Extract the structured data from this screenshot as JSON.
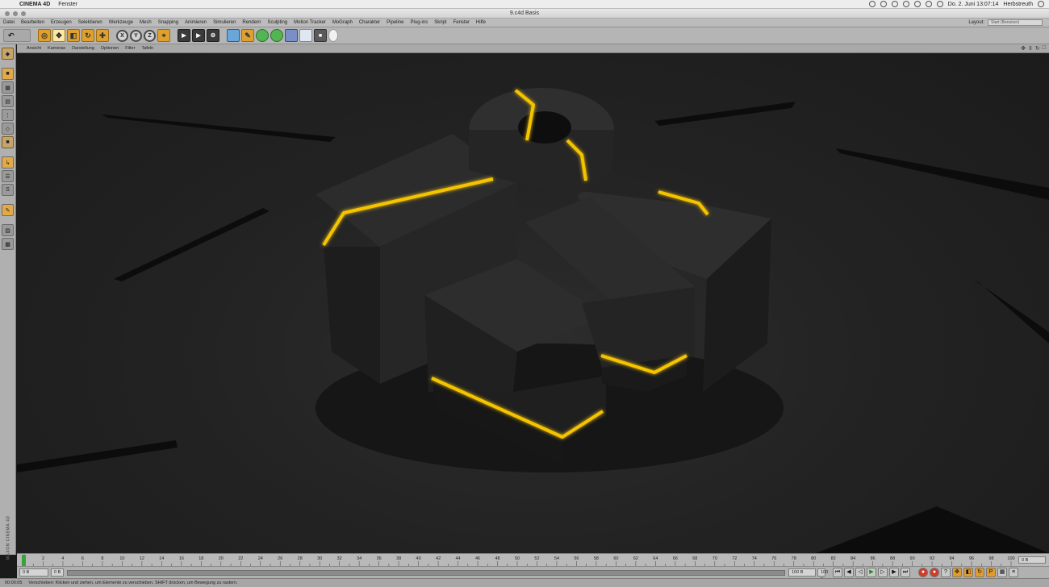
{
  "menubar": {
    "app_name": "CINEMA 4D",
    "items": [
      "Fenster"
    ],
    "clock": "Do. 2. Juni  13:07:14",
    "user": "Herbstreuth"
  },
  "window": {
    "title": "9.c4d   Basis"
  },
  "c4d_menu": {
    "items": [
      "Datei",
      "Bearbeiten",
      "Erzeugen",
      "Selektieren",
      "Werkzeuge",
      "Mesh",
      "Snapping",
      "Animieren",
      "Simulieren",
      "Rendern",
      "Sculpting",
      "Motion Tracker",
      "MoGraph",
      "Charakter",
      "Pipeline",
      "Plug-ins",
      "Skript",
      "Fenster",
      "Hilfe"
    ],
    "layout_label": "Layout:",
    "layout_value": "Start (Benutzer)"
  },
  "toolbar": {
    "undo_icon": "undo-icon",
    "axis_x": "X",
    "axis_y": "Y",
    "axis_z": "Z"
  },
  "viewport_menu": {
    "items": [
      "Ansicht",
      "Kameras",
      "Darstellung",
      "Optionen",
      "Filter",
      "Tafeln"
    ]
  },
  "viewport": {
    "background": "#242424",
    "glow_color": "#f5c400"
  },
  "timeline": {
    "ticks": [
      "0",
      "2",
      "4",
      "6",
      "8",
      "10",
      "12",
      "14",
      "16",
      "18",
      "20",
      "22",
      "24",
      "26",
      "28",
      "30",
      "32",
      "34",
      "36",
      "38",
      "40",
      "42",
      "44",
      "46",
      "48",
      "50",
      "52",
      "54",
      "56",
      "58",
      "60",
      "62",
      "64",
      "66",
      "68",
      "70",
      "72",
      "74",
      "76",
      "78",
      "80",
      "82",
      "84",
      "86",
      "88",
      "90",
      "92",
      "94",
      "96",
      "98",
      "100"
    ],
    "end_frame": "0 B"
  },
  "transport": {
    "start_field": "0 B",
    "range_start": "0 B",
    "end_field": "100 B",
    "max_field": "100 B"
  },
  "status": {
    "time": "00:00:05",
    "message": "Verschieben: Klicken und ziehen, um Elemente zu verschieben. SHIFT drücken, um Bewegung zu rastern."
  }
}
